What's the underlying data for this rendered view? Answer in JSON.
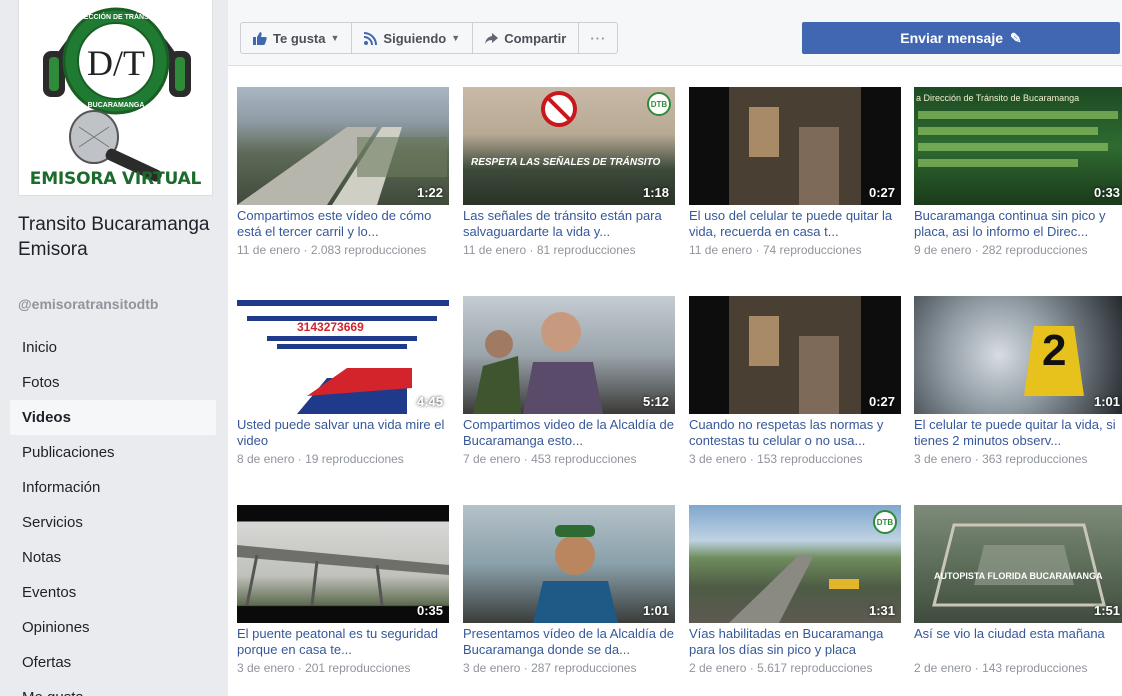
{
  "page": {
    "logo_ring_text": "DIRECCIÓN DE TRÁNSITO",
    "logo_bottom_text": "BUCARAMANGA",
    "logo_letters": "D/T",
    "brand_label": "EMISORA VIRTUAL",
    "name": "Transito Bucaramanga Emisora",
    "handle": "@emisoratransitodtb"
  },
  "nav": [
    {
      "label": "Inicio"
    },
    {
      "label": "Fotos"
    },
    {
      "label": "Videos",
      "active": true
    },
    {
      "label": "Publicaciones"
    },
    {
      "label": "Información"
    },
    {
      "label": "Servicios"
    },
    {
      "label": "Notas"
    },
    {
      "label": "Eventos"
    },
    {
      "label": "Opiniones"
    },
    {
      "label": "Ofertas"
    },
    {
      "label": "Me gusta"
    }
  ],
  "actions": {
    "like_label": "Te gusta",
    "following_label": "Siguiendo",
    "share_label": "Compartir",
    "more_label": "···",
    "send_message_label": "Enviar mensaje",
    "accent_color": "#4267b2"
  },
  "videos": [
    {
      "duration": "1:22",
      "title": "Compartimos este vídeo de cómo está el tercer carril y lo...",
      "date": "11 de enero",
      "views": "2.083 reproducciones"
    },
    {
      "duration": "1:18",
      "title": "Las señales de tránsito están para salvaguardarte la vida y...",
      "date": "11 de enero",
      "views": "81 reproducciones",
      "overlay": "RESPETA LAS SEÑALES DE TRÁNSITO"
    },
    {
      "duration": "0:27",
      "title": "El uso del celular te puede quitar la vida, recuerda en casa t...",
      "date": "11 de enero",
      "views": "74 reproducciones"
    },
    {
      "duration": "0:33",
      "title": "Bucaramanga continua sin pico y placa, asi lo informo el Direc...",
      "date": "9 de enero",
      "views": "282 reproducciones",
      "overlay": "a Dirección de Tránsito de Bucaramanga"
    },
    {
      "duration": "4:45",
      "title": "Usted puede salvar una vida mire el video",
      "date": "8 de enero",
      "views": "19 reproducciones",
      "overlay": "3143273669"
    },
    {
      "duration": "5:12",
      "title": "Compartimos video de la Alcaldía de Bucaramanga esto...",
      "date": "7 de enero",
      "views": "453 reproducciones"
    },
    {
      "duration": "0:27",
      "title": "Cuando no respetas las normas y contestas tu celular o no usa...",
      "date": "3 de enero",
      "views": "153 reproducciones"
    },
    {
      "duration": "1:01",
      "title": "El celular te puede quitar la vida, si tienes 2 minutos observ...",
      "date": "3 de enero",
      "views": "363 reproducciones",
      "overlay": "2"
    },
    {
      "duration": "0:35",
      "title": "El puente peatonal es tu seguridad porque en casa te...",
      "date": "3 de enero",
      "views": "201 reproducciones"
    },
    {
      "duration": "1:01",
      "title": "Presentamos vídeo de la Alcaldía de Bucaramanga donde se da...",
      "date": "3 de enero",
      "views": "287 reproducciones"
    },
    {
      "duration": "1:31",
      "title": "Vías habilitadas en Bucaramanga para los días sin pico y placa",
      "date": "2 de enero",
      "views": "5.617 reproducciones"
    },
    {
      "duration": "1:51",
      "title": "Así se vio la ciudad esta mañana",
      "date": "2 de enero",
      "views": "143 reproducciones",
      "overlay": "AUTOPISTA FLORIDA BUCARAMANGA"
    }
  ]
}
